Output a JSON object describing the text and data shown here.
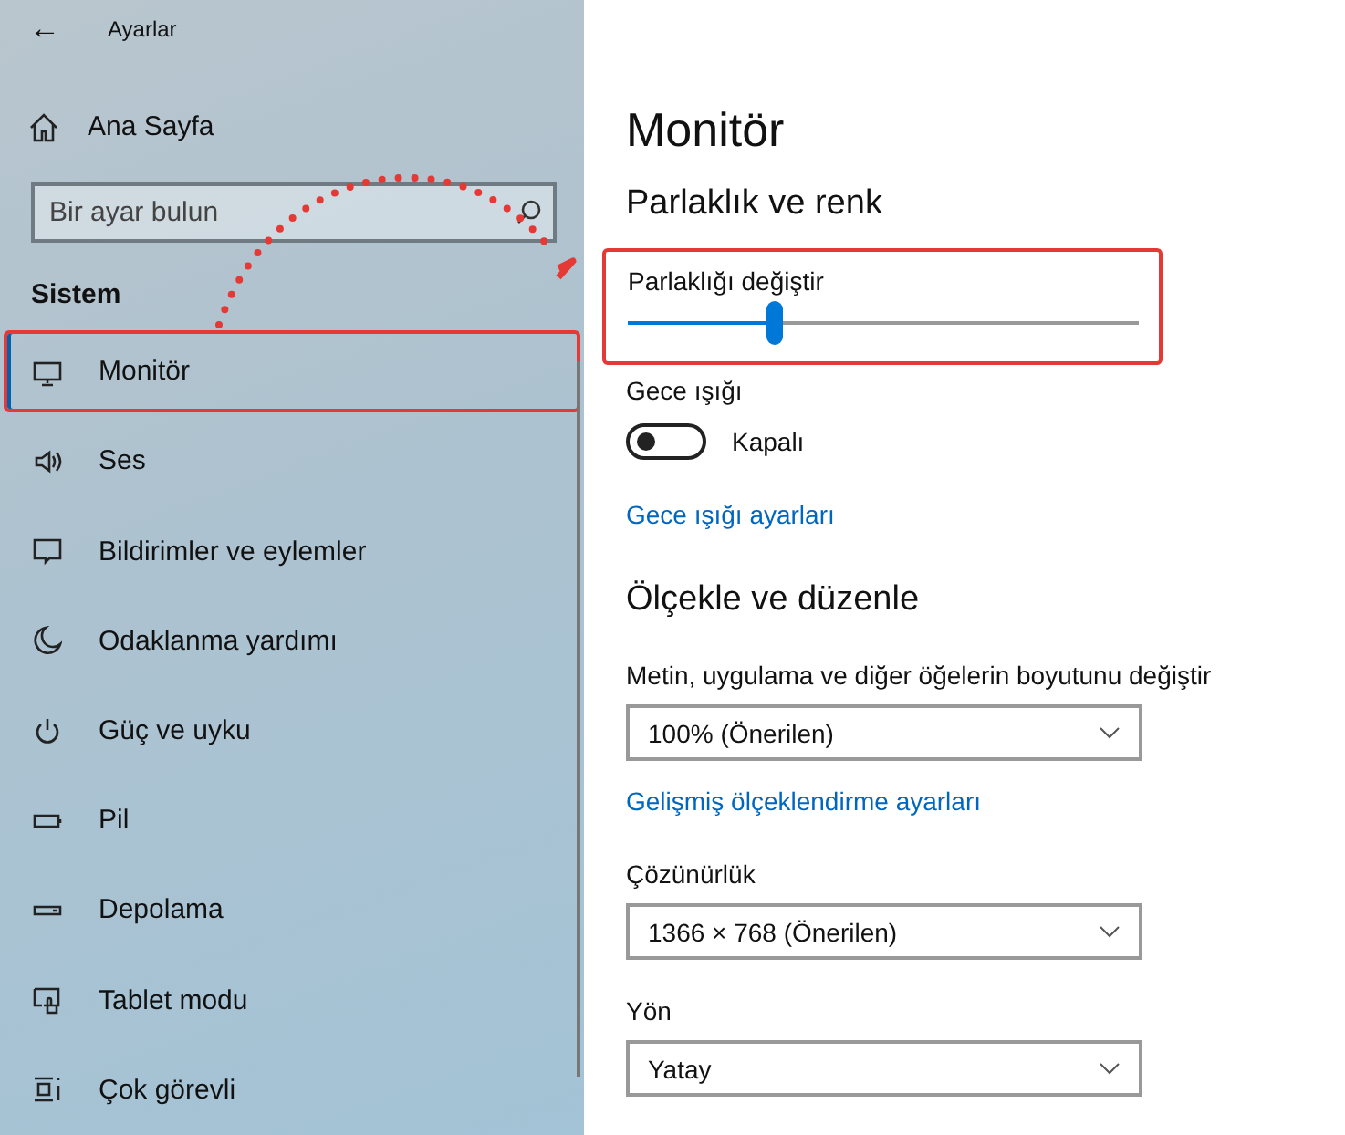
{
  "window": {
    "title": "Ayarlar",
    "back": "←"
  },
  "home": {
    "label": "Ana Sayfa"
  },
  "search": {
    "placeholder": "Bir ayar bulun"
  },
  "sidebar": {
    "section": "Sistem",
    "items": [
      {
        "label": "Monitör",
        "selected": true,
        "highlighted": true
      },
      {
        "label": "Ses",
        "selected": false,
        "highlighted": false
      },
      {
        "label": "Bildirimler ve eylemler",
        "selected": false,
        "highlighted": false
      },
      {
        "label": "Odaklanma yardımı",
        "selected": false,
        "highlighted": false
      },
      {
        "label": "Güç ve uyku",
        "selected": false,
        "highlighted": false
      },
      {
        "label": "Pil",
        "selected": false,
        "highlighted": false
      },
      {
        "label": "Depolama",
        "selected": false,
        "highlighted": false
      },
      {
        "label": "Tablet modu",
        "selected": false,
        "highlighted": false
      },
      {
        "label": "Çok görevli",
        "selected": false,
        "highlighted": false
      }
    ]
  },
  "page": {
    "title": "Monitör",
    "brightness_section": {
      "heading": "Parlaklık ve renk",
      "slider": {
        "label": "Parlaklığı değiştir",
        "level": 0.286,
        "highlighted": true
      },
      "night_light": {
        "label": "Gece ışığı",
        "on": false,
        "state_text": "Kapalı"
      },
      "link": "Gece ışığı ayarları"
    },
    "scale_section": {
      "heading": "Ölçekle ve düzenle",
      "scale": {
        "label": "Metin, uygulama ve diğer öğelerin boyutunu değiştir",
        "value": "100% (Önerilen)"
      },
      "link": "Gelişmiş ölçeklendirme ayarları",
      "resolution": {
        "label": "Çözünürlük",
        "value": "1366 × 768 (Önerilen)"
      },
      "orientation": {
        "label": "Yön",
        "value": "Yatay"
      }
    }
  }
}
